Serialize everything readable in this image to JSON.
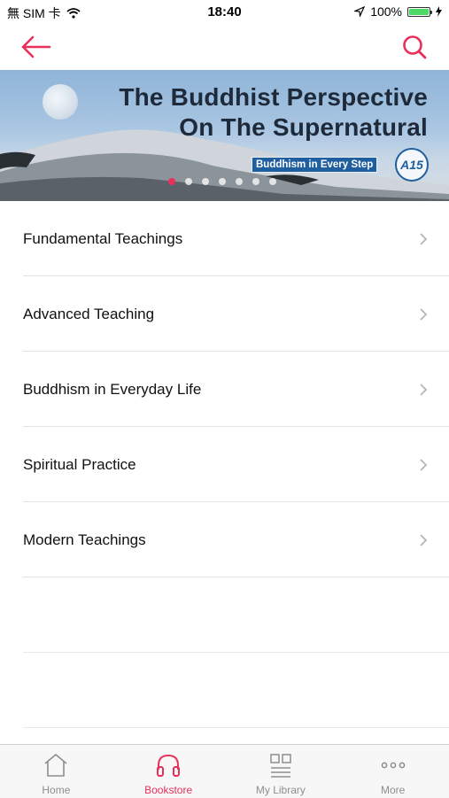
{
  "status_bar": {
    "carrier": "無 SIM 卡",
    "time": "18:40",
    "battery": "100%"
  },
  "nav": {
    "back_icon": "arrow-left-icon",
    "search_icon": "search-icon",
    "accent": "#e8305a"
  },
  "banner": {
    "title_line1": "The Buddhist Perspective",
    "title_line2": "On The Supernatural",
    "series_tag": "Buddhism in Every Step",
    "series_code": "A15",
    "slide_count": 7,
    "active_slide": 1
  },
  "categories": [
    {
      "label": "Fundamental Teachings"
    },
    {
      "label": "Advanced Teaching"
    },
    {
      "label": "Buddhism in Everyday Life"
    },
    {
      "label": "Spiritual Practice"
    },
    {
      "label": "Modern Teachings"
    }
  ],
  "tabbar": {
    "tabs": [
      {
        "label": "Home",
        "icon": "home-icon"
      },
      {
        "label": "Bookstore",
        "icon": "headphones-icon",
        "active": true
      },
      {
        "label": "My Library",
        "icon": "library-icon"
      },
      {
        "label": "More",
        "icon": "more-icon"
      }
    ]
  }
}
